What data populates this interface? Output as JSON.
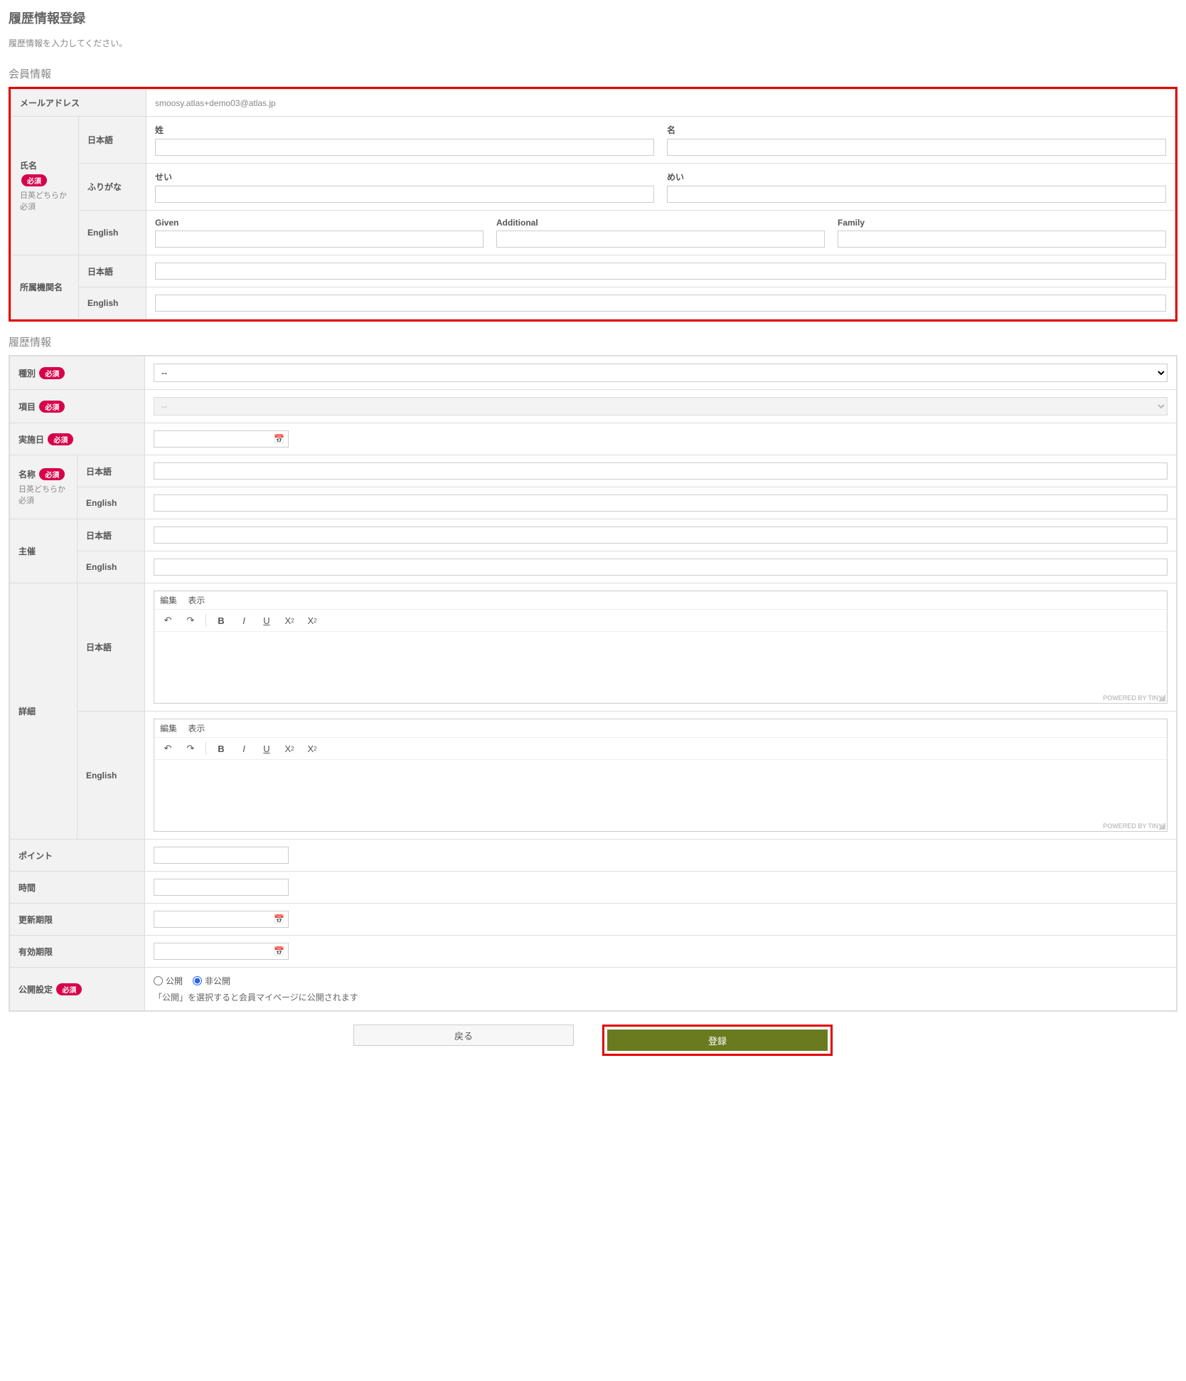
{
  "page": {
    "title": "履歴情報登録",
    "description": "履歴情報を入力してください。"
  },
  "sections": {
    "member": "会員情報",
    "history": "履歴情報"
  },
  "labels": {
    "email": "メールアドレス",
    "name": "氏名",
    "required": "必須",
    "either_jp_en": "日英どちらか必須",
    "japanese": "日本語",
    "furigana": "ふりがな",
    "english": "English",
    "sei": "姓",
    "mei": "名",
    "sei_kana": "せい",
    "mei_kana": "めい",
    "given": "Given",
    "additional": "Additional",
    "family": "Family",
    "affiliation": "所属機関名",
    "type": "種別",
    "item": "項目",
    "impl_date": "実施日",
    "title_name": "名称",
    "organizer": "主催",
    "details": "詳細",
    "points": "ポイント",
    "hours": "時間",
    "update_due": "更新期限",
    "valid_until": "有効期限",
    "publish": "公開設定",
    "publish_public": "公開",
    "publish_private": "非公開",
    "publish_note": "「公開」を選択すると会員マイページに公開されます"
  },
  "values": {
    "email": "smoosy.atlas+demo03@atlas.jp",
    "type_selected": "--",
    "item_selected": "--"
  },
  "editor": {
    "menu_edit": "編集",
    "menu_view": "表示",
    "powered": "POWERED BY TINY"
  },
  "buttons": {
    "back": "戻る",
    "submit": "登録"
  }
}
